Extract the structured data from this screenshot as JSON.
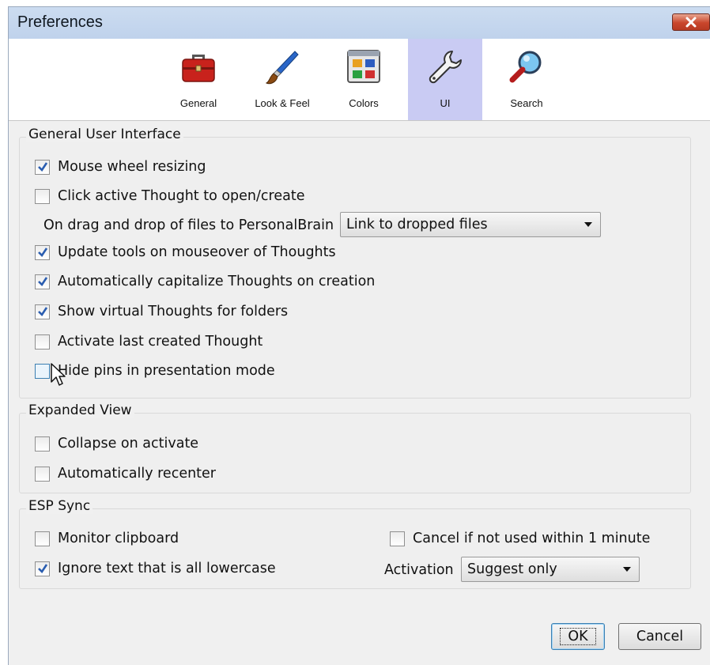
{
  "window": {
    "title": "Preferences"
  },
  "toolbar": {
    "tabs": [
      {
        "label": "General",
        "icon": "toolbox-icon"
      },
      {
        "label": "Look & Feel",
        "icon": "paintbrush-icon"
      },
      {
        "label": "Colors",
        "icon": "palette-grid-icon"
      },
      {
        "label": "UI",
        "icon": "wrench-icon",
        "selected": true
      },
      {
        "label": "Search",
        "icon": "magnifier-icon"
      }
    ]
  },
  "general_ui": {
    "title": "General User Interface",
    "mouse_wheel": {
      "label": "Mouse wheel resizing",
      "checked": true
    },
    "click_active": {
      "label": "Click active Thought to open/create",
      "checked": false
    },
    "drag_drop": {
      "label": "On drag and drop of files to PersonalBrain",
      "value": "Link to dropped files"
    },
    "update_tools": {
      "label": "Update tools on mouseover of Thoughts",
      "checked": true
    },
    "auto_capitalize": {
      "label": "Automatically capitalize Thoughts on creation",
      "checked": true
    },
    "virtual_thoughts": {
      "label": "Show virtual Thoughts for folders",
      "checked": true
    },
    "activate_last": {
      "label": "Activate last created Thought",
      "checked": false
    },
    "hide_pins": {
      "label": "Hide pins in presentation mode",
      "checked": false
    }
  },
  "expanded_view": {
    "title": "Expanded View",
    "collapse": {
      "label": "Collapse on activate",
      "checked": false
    },
    "recenter": {
      "label": "Automatically recenter",
      "checked": false
    }
  },
  "esp_sync": {
    "title": "ESP Sync",
    "monitor_clipboard": {
      "label": "Monitor clipboard",
      "checked": false
    },
    "ignore_lowercase": {
      "label": "Ignore text that is all lowercase",
      "checked": true
    },
    "cancel_unused": {
      "label": "Cancel if not used within 1 minute",
      "checked": false
    },
    "activation": {
      "label": "Activation",
      "value": "Suggest only"
    }
  },
  "buttons": {
    "ok": "OK",
    "cancel": "Cancel"
  },
  "colors": {
    "selected_tab": "#c9cbf3",
    "check": "#2a5db0"
  }
}
